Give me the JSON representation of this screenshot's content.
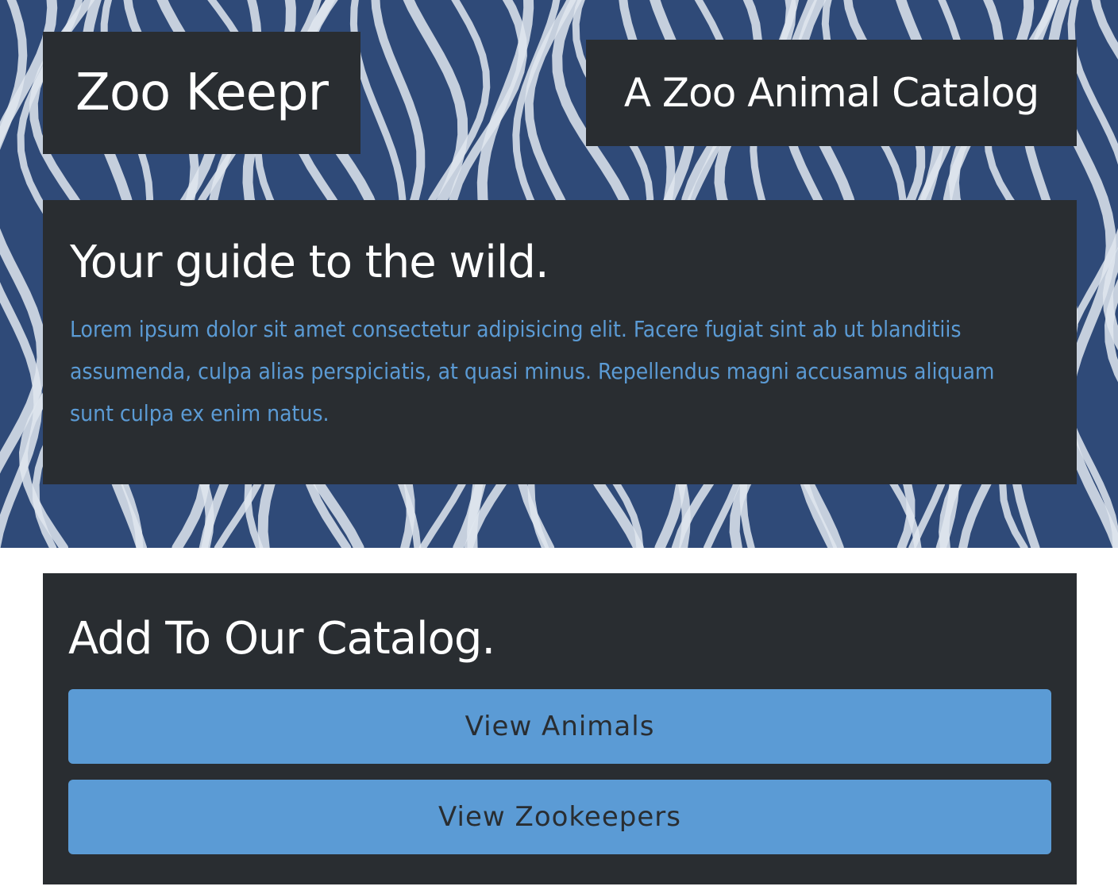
{
  "colors": {
    "panel": "#292d31",
    "accent": "#5b9bd5",
    "hero_background": "#2f4a78",
    "stripe": "#dfe6ee"
  },
  "header": {
    "brand": "Zoo Keepr",
    "tagline": "A Zoo Animal Catalog"
  },
  "hero": {
    "background_image": "zebra-stripes",
    "heading": "Your guide to the wild.",
    "body": "Lorem ipsum dolor sit amet consectetur adipisicing elit. Facere fugiat sint ab ut blanditiis assumenda, culpa alias perspiciatis, at quasi minus. Repellendus magni accusamus aliquam sunt culpa ex enim natus."
  },
  "catalog": {
    "heading": "Add To Our Catalog.",
    "buttons": [
      {
        "label": "View Animals"
      },
      {
        "label": "View Zookeepers"
      }
    ]
  }
}
